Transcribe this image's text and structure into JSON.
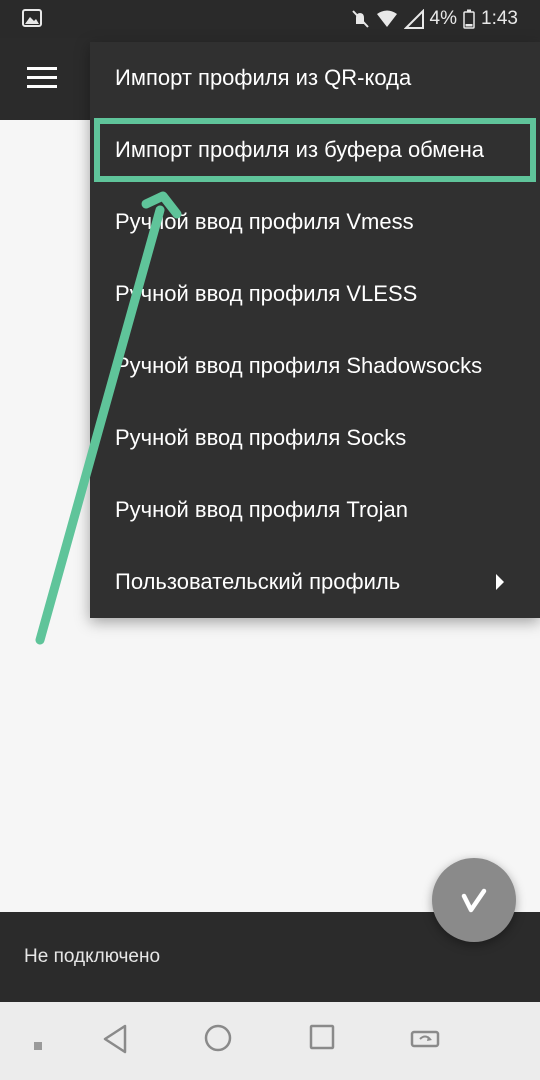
{
  "status_bar": {
    "battery_percent": "4%",
    "time": "1:43"
  },
  "menu": {
    "items": [
      {
        "label": "Импорт профиля из QR-кода",
        "icon": ""
      },
      {
        "label": "Импорт профиля из буфера обмена",
        "icon": ""
      },
      {
        "label": "Ручной ввод профиля Vmess",
        "icon": ""
      },
      {
        "label": "Ручной ввод профиля VLESS",
        "icon": ""
      },
      {
        "label": "Ручной ввод профиля Shadowsocks",
        "icon": ""
      },
      {
        "label": "Ручной ввод профиля Socks",
        "icon": ""
      },
      {
        "label": "Ручной ввод профиля Trojan",
        "icon": ""
      },
      {
        "label": "Пользовательский профиль",
        "icon": "submenu-arrow-icon"
      }
    ]
  },
  "bottom": {
    "connection_status": "Не подключено"
  },
  "colors": {
    "highlight": "#5fc49a",
    "menu_bg": "#303030",
    "bar_bg": "#2b2b2b",
    "fab": "#8a8a8a"
  }
}
